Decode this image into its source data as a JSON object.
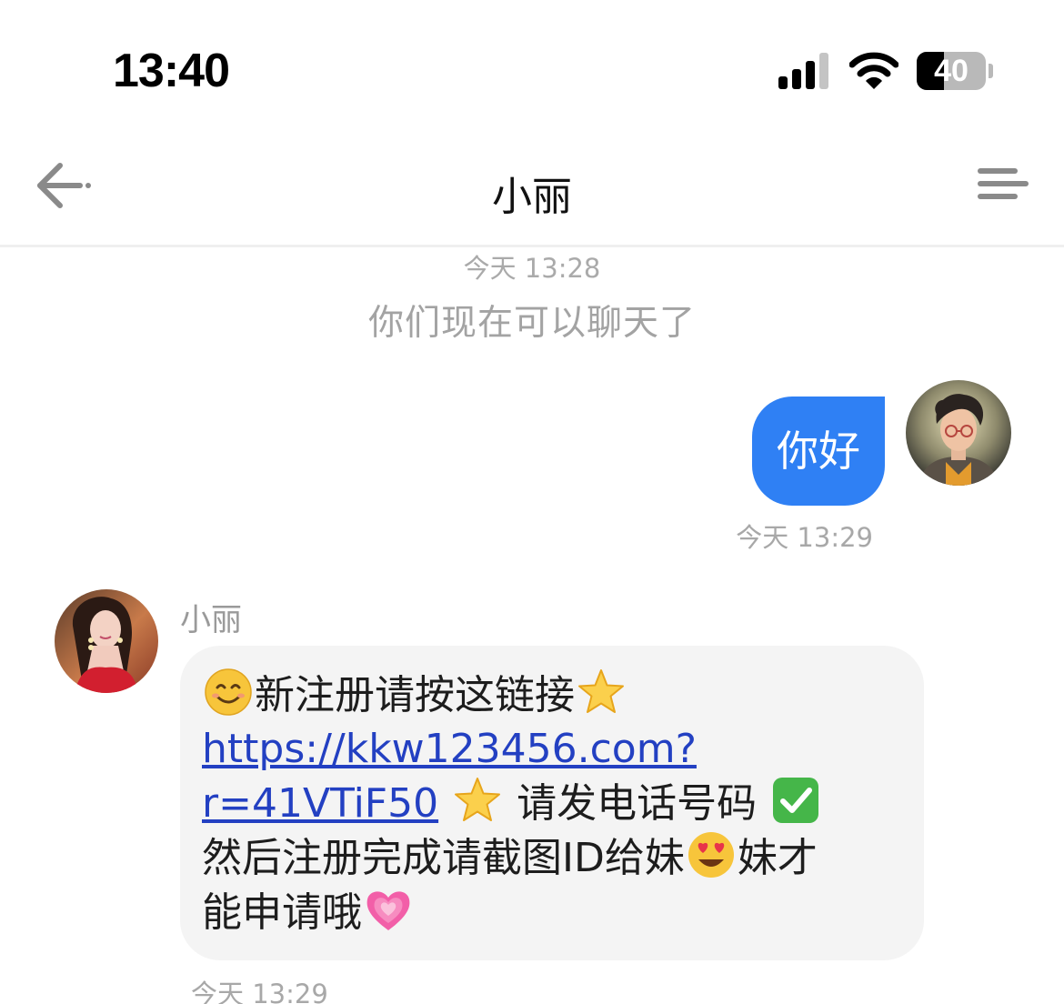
{
  "status_bar": {
    "time": "13:40",
    "battery_level": "40",
    "battery_fraction": 0.4,
    "icons": [
      "signal-icon",
      "wifi-icon",
      "battery-icon"
    ]
  },
  "header": {
    "back_icon": "back-arrow-icon",
    "title": "小丽",
    "menu_icon": "menu-icon"
  },
  "chat": {
    "system_time": "今天 13:28",
    "system_notice": "你们现在可以聊天了",
    "messages": [
      {
        "sender": "self",
        "text": "你好",
        "time": "今天 13:29",
        "avatar": "avatar-cartoon-boy"
      },
      {
        "sender": "peer",
        "name": "小丽",
        "avatar": "avatar-woman-red-dress",
        "part1": "新注册请按这链接",
        "link_line1": "https://kkw123456.com?",
        "link_line2": "r=41VTiF50",
        "part2": "请发电话号码",
        "part3": "然后注册完成请截图ID给妹",
        "part4": "妹才",
        "part5": "能申请哦",
        "emojis": [
          "smiling-face",
          "star",
          "star",
          "check-mark",
          "heart-eyes",
          "growing-heart"
        ],
        "time": "今天 13:29"
      }
    ]
  },
  "colors": {
    "self_bubble": "#2f80f4",
    "peer_bubble": "#f4f4f4",
    "link": "#2340c2",
    "muted_text": "#a8a8a8"
  }
}
